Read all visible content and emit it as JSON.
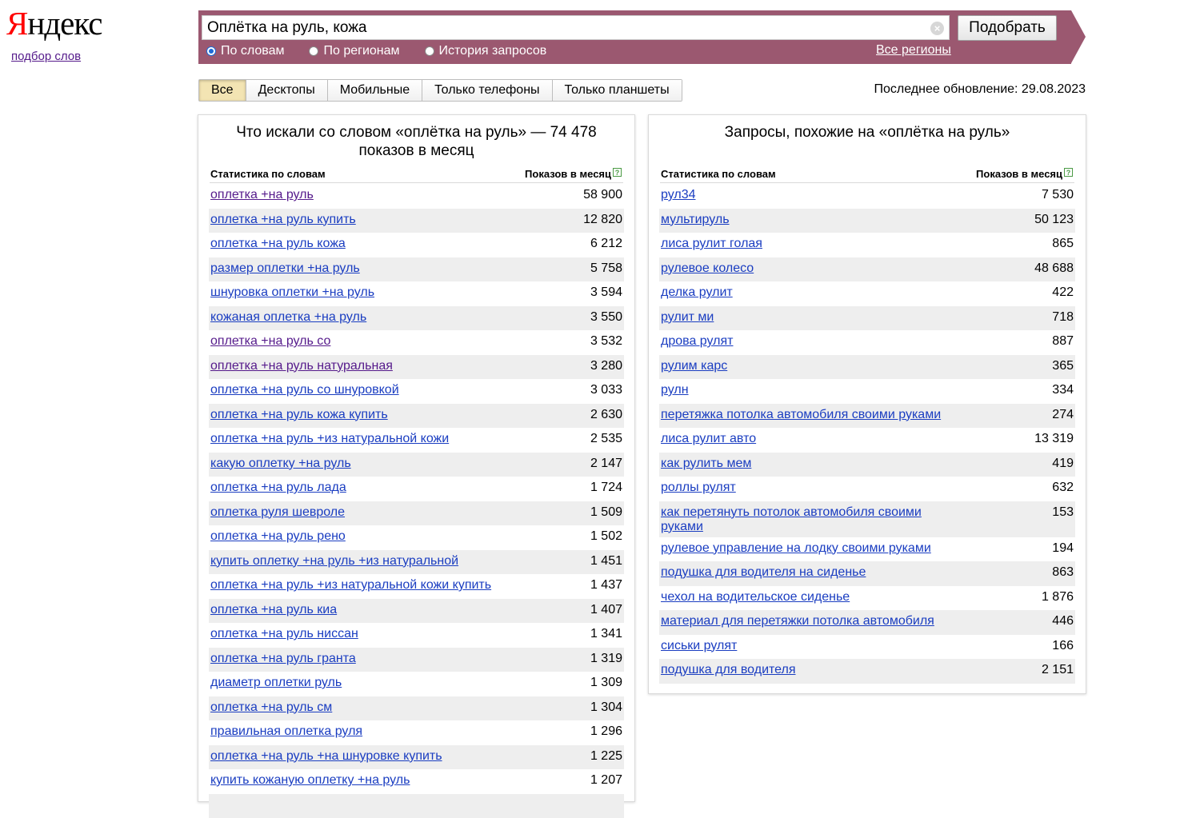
{
  "logo": {
    "first": "Я",
    "rest": "ндекс",
    "subtitle": "подбор слов"
  },
  "search": {
    "query": "Оплётка на руль, кожа",
    "clear_glyph": "×",
    "submit_label": "Подобрать",
    "modes": [
      {
        "label": "По словам",
        "checked": true
      },
      {
        "label": "По регионам",
        "checked": false
      },
      {
        "label": "История запросов",
        "checked": false
      }
    ],
    "regions_link": "Все регионы"
  },
  "device_tabs": [
    {
      "label": "Все",
      "active": true
    },
    {
      "label": "Десктопы",
      "active": false
    },
    {
      "label": "Мобильные",
      "active": false
    },
    {
      "label": "Только телефоны",
      "active": false
    },
    {
      "label": "Только планшеты",
      "active": false
    }
  ],
  "last_update": "Последнее обновление: 29.08.2023",
  "left_panel": {
    "title_line1": "Что искали со словом «оплётка на руль» — 74 478",
    "title_line2": "показов в месяц",
    "col_keyword": "Статистика по словам",
    "col_count": "Показов в месяц",
    "help_glyph": "?",
    "rows": [
      {
        "keyword": "оплетка +на руль",
        "count": "58 900",
        "visited": true
      },
      {
        "keyword": "оплетка +на руль купить",
        "count": "12 820"
      },
      {
        "keyword": "оплетка +на руль кожа",
        "count": "6 212"
      },
      {
        "keyword": "размер оплетки +на руль",
        "count": "5 758"
      },
      {
        "keyword": "шнуровка оплетки +на руль",
        "count": "3 594"
      },
      {
        "keyword": "кожаная оплетка +на руль",
        "count": "3 550"
      },
      {
        "keyword": "оплетка +на руль со",
        "count": "3 532",
        "visited": true
      },
      {
        "keyword": "оплетка +на руль натуральная",
        "count": "3 280",
        "visited": true
      },
      {
        "keyword": "оплетка +на руль со шнуровкой",
        "count": "3 033"
      },
      {
        "keyword": "оплетка +на руль кожа купить",
        "count": "2 630"
      },
      {
        "keyword": "оплетка +на руль +из натуральной кожи",
        "count": "2 535"
      },
      {
        "keyword": "какую оплетку +на руль",
        "count": "2 147"
      },
      {
        "keyword": "оплетка +на руль лада",
        "count": "1 724"
      },
      {
        "keyword": "оплетка руля шевроле",
        "count": "1 509"
      },
      {
        "keyword": "оплетка +на руль рено",
        "count": "1 502"
      },
      {
        "keyword": "купить оплетку +на руль +из натуральной",
        "count": "1 451"
      },
      {
        "keyword": "оплетка +на руль +из натуральной кожи купить",
        "count": "1 437"
      },
      {
        "keyword": "оплетка +на руль киа",
        "count": "1 407"
      },
      {
        "keyword": "оплетка +на руль ниссан",
        "count": "1 341"
      },
      {
        "keyword": "оплетка +на руль гранта",
        "count": "1 319"
      },
      {
        "keyword": "диаметр оплетки руль",
        "count": "1 309"
      },
      {
        "keyword": "оплетка +на руль см",
        "count": "1 304"
      },
      {
        "keyword": "правильная оплетка руля",
        "count": "1 296"
      },
      {
        "keyword": "оплетка +на руль +на шнуровке купить",
        "count": "1 225"
      },
      {
        "keyword": "купить кожаную оплетку +на руль",
        "count": "1 207"
      },
      {
        "keyword": "",
        "count": ""
      }
    ]
  },
  "right_panel": {
    "title": "Запросы, похожие на «оплётка на руль»",
    "col_keyword": "Статистика по словам",
    "col_count": "Показов в месяц",
    "help_glyph": "?",
    "rows": [
      {
        "keyword": "рул34",
        "count": "7 530"
      },
      {
        "keyword": "мультируль",
        "count": "50 123"
      },
      {
        "keyword": "лиса рулит голая",
        "count": "865"
      },
      {
        "keyword": "рулевое колесо",
        "count": "48 688"
      },
      {
        "keyword": "делка рулит",
        "count": "422"
      },
      {
        "keyword": "рулит ми",
        "count": "718"
      },
      {
        "keyword": "дрова рулят",
        "count": "887"
      },
      {
        "keyword": "рулим карс",
        "count": "365"
      },
      {
        "keyword": "рулн",
        "count": "334"
      },
      {
        "keyword": "перетяжка потолка автомобиля своими руками",
        "count": "274"
      },
      {
        "keyword": "лиса рулит авто",
        "count": "13 319"
      },
      {
        "keyword": "как рулить мем",
        "count": "419"
      },
      {
        "keyword": "роллы рулят",
        "count": "632"
      },
      {
        "keyword": "как перетянуть потолок автомобиля своими руками",
        "count": "153"
      },
      {
        "keyword": "рулевое управление на лодку своими руками",
        "count": "194"
      },
      {
        "keyword": "подушка для водителя на сиденье",
        "count": "863"
      },
      {
        "keyword": "чехол на водительское сиденье",
        "count": "1 876"
      },
      {
        "keyword": "материал для перетяжки потолка автомобиля",
        "count": "446"
      },
      {
        "keyword": "сиськи рулят",
        "count": "166"
      },
      {
        "keyword": "подушка для водителя",
        "count": "2 151"
      }
    ]
  }
}
